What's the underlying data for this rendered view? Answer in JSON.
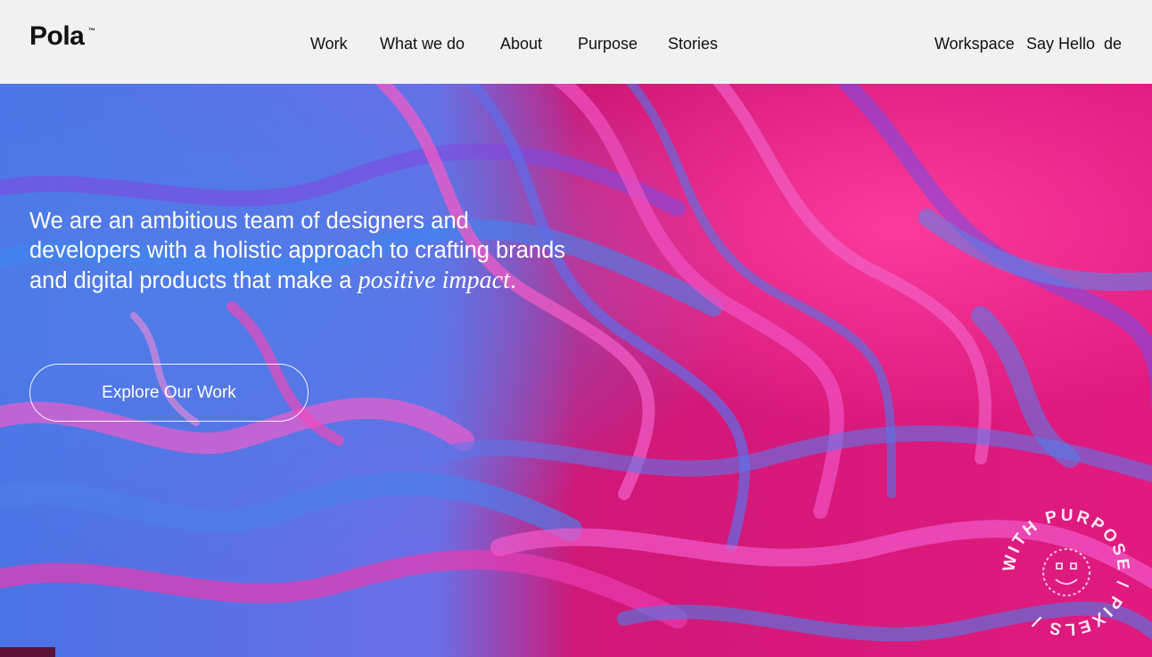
{
  "header": {
    "logo": "Pola",
    "logo_tm": "™",
    "nav": [
      "Work",
      "What we do",
      "About",
      "Purpose",
      "Stories"
    ],
    "utility": [
      "Workspace",
      "Say Hello",
      "de"
    ]
  },
  "hero": {
    "text_before": "We are an ambitious team of designers and developers with a holistic approach to crafting brands and digital products that make a ",
    "text_emphasis": "positive impact",
    "text_after": ".",
    "cta_label": "Explore Our Work",
    "badge_text": "WITH PURPOSE / PIXELS /"
  },
  "colors": {
    "header_bg": "#f1f1f1",
    "magenta": "#e0147a",
    "blue": "#4e74e6",
    "pink": "#f45bc8",
    "purple": "#8a3ad8"
  },
  "icons": {
    "badge": "smiley-face-icon"
  }
}
